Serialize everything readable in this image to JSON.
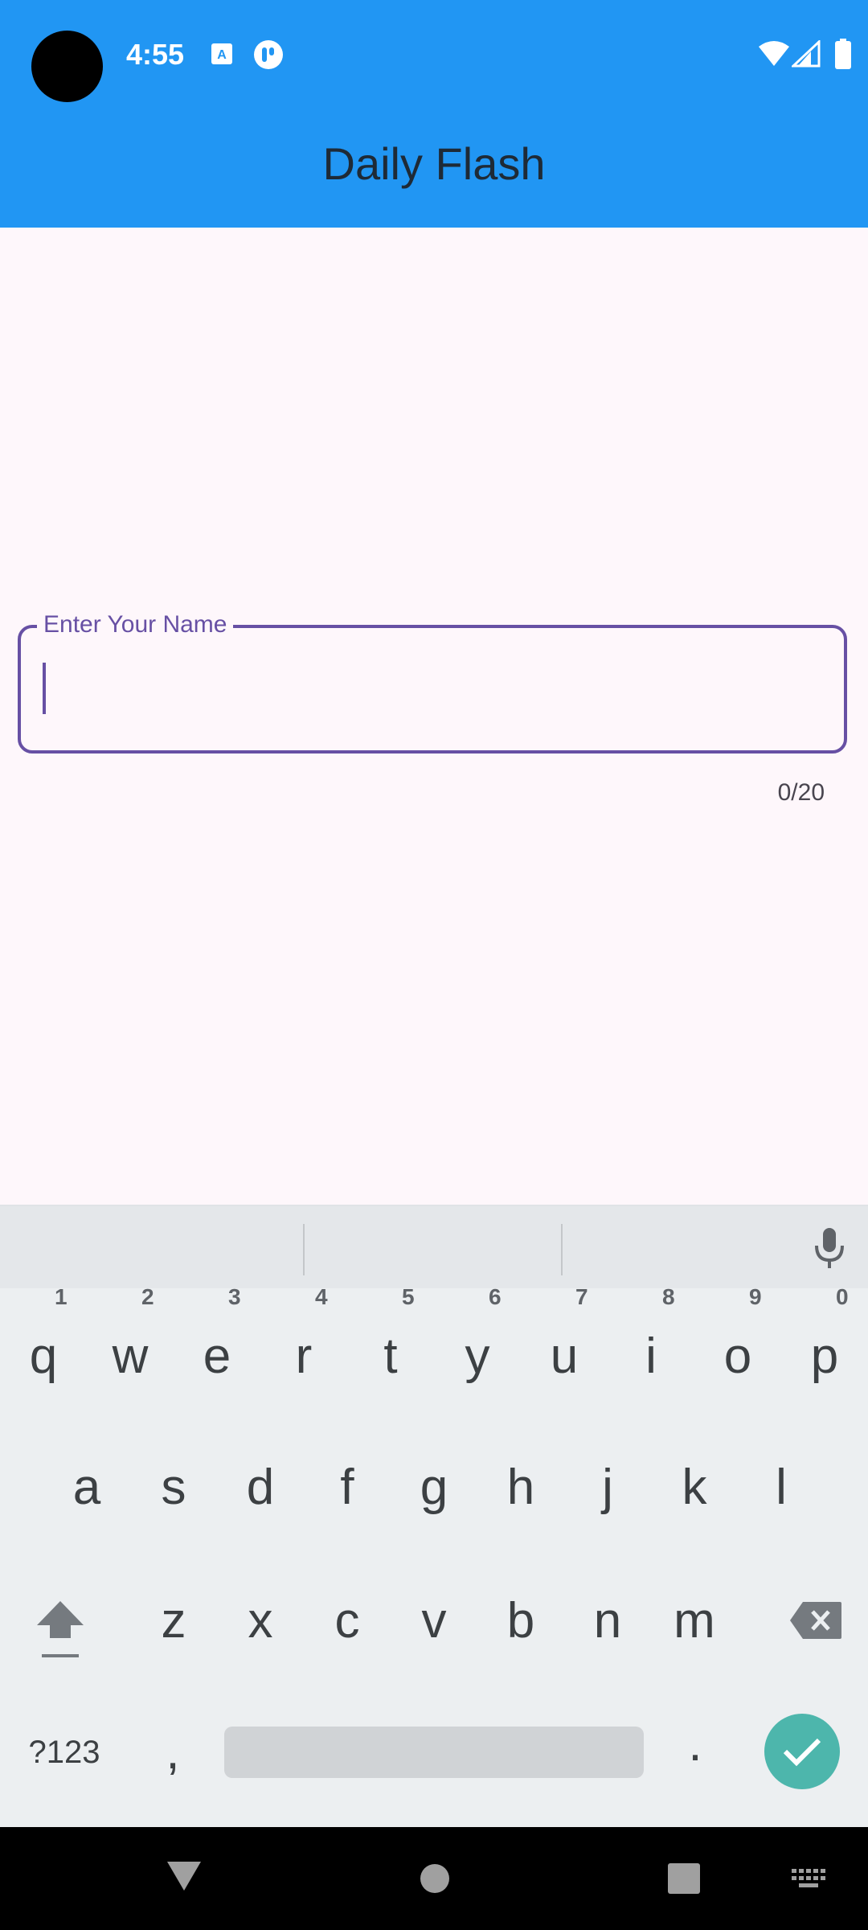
{
  "status_bar": {
    "time": "4:55"
  },
  "app_bar": {
    "title": "Daily Flash"
  },
  "name_field": {
    "label": "Enter Your Name",
    "value": "",
    "counter": "0/20"
  },
  "keyboard": {
    "row1": [
      "q",
      "w",
      "e",
      "r",
      "t",
      "y",
      "u",
      "i",
      "o",
      "p"
    ],
    "row1_hints": [
      "1",
      "2",
      "3",
      "4",
      "5",
      "6",
      "7",
      "8",
      "9",
      "0"
    ],
    "row2": [
      "a",
      "s",
      "d",
      "f",
      "g",
      "h",
      "j",
      "k",
      "l"
    ],
    "row3": [
      "z",
      "x",
      "c",
      "v",
      "b",
      "n",
      "m"
    ],
    "symbols_label": "?123",
    "comma": ",",
    "period": "."
  },
  "colors": {
    "app_bar": "#2196f3",
    "accent": "#6750a4",
    "enter_key": "#4db6ac"
  }
}
